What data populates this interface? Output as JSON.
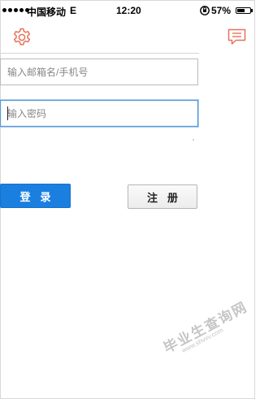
{
  "status_bar": {
    "carrier": "中国移动",
    "network": "E",
    "time": "12:20",
    "battery_text": "57%",
    "battery_level": 0.57,
    "signal_dots": 5
  },
  "top_bar": {
    "left_icon": "gear-icon",
    "right_icon": "message-icon",
    "accent_color": "#e8715a"
  },
  "login_form": {
    "username_placeholder": "输入邮箱名/手机号",
    "username_value": "",
    "password_placeholder": "输入密码",
    "password_value": "",
    "login_label": "登录",
    "register_label": "注册",
    "login_color": "#1b7fe0"
  },
  "watermark": {
    "title": "毕业生查询网",
    "url": "www.shvvv.com"
  }
}
